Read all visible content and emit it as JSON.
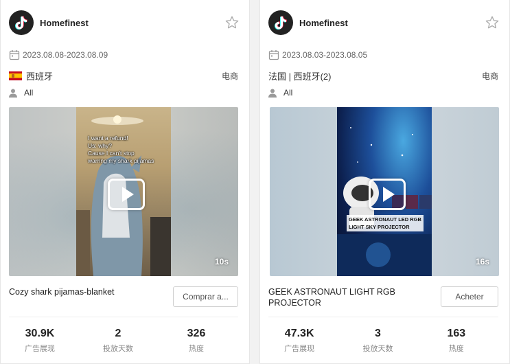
{
  "cards": [
    {
      "account": "Homefinest",
      "date_range": "2023.08.08-2023.08.09",
      "region": "西班牙",
      "category": "电商",
      "audience": "All",
      "duration": "10s",
      "caption_lines": [
        "I want a refund!",
        "Us: why?",
        "Cause I can't stop",
        "warring my shark pijamas"
      ],
      "title": "Cozy shark pijamas-blanket",
      "button": "Comprar a...",
      "stats": [
        {
          "value": "30.9K",
          "label": "广告展现"
        },
        {
          "value": "2",
          "label": "投放天数"
        },
        {
          "value": "326",
          "label": "热度"
        }
      ]
    },
    {
      "account": "Homefinest",
      "date_range": "2023.08.03-2023.08.05",
      "region": "法国 | 西班牙(2)",
      "category": "电商",
      "audience": "All",
      "duration": "16s",
      "caption_lines": [
        "GEEK ASTRONAUT LED RGB",
        "LIGHT SKY PROJECTOR"
      ],
      "title": "GEEK ASTRONAUT LIGHT RGB PROJECTOR",
      "button": "Acheter",
      "stats": [
        {
          "value": "47.3K",
          "label": "广告展现"
        },
        {
          "value": "3",
          "label": "投放天数"
        },
        {
          "value": "163",
          "label": "热度"
        }
      ]
    }
  ],
  "icons": {
    "logo": "tiktok-logo-icon",
    "favorite": "star-outline-icon",
    "date": "calendar-icon",
    "audience": "user-icon",
    "play": "play-icon"
  },
  "colors": {
    "card_bg": "#ffffff",
    "page_bg": "#f2f2f2",
    "text": "#222222",
    "muted": "#888888"
  }
}
